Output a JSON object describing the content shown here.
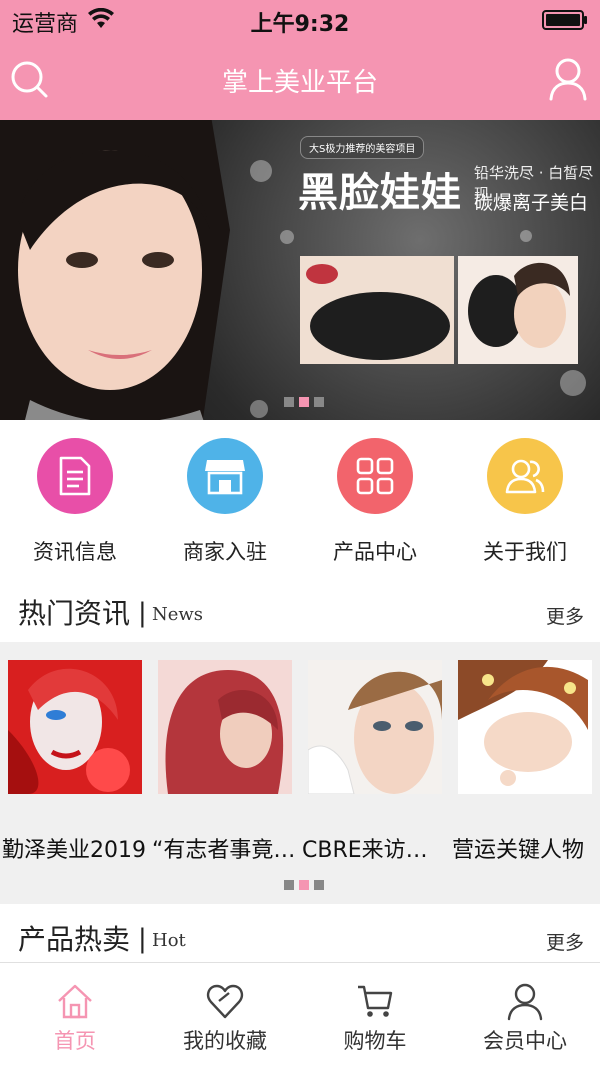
{
  "status_bar": {
    "carrier": "运营商",
    "time": "上午9:32"
  },
  "header": {
    "title": "掌上美业平台"
  },
  "banner": {
    "tag": "大S极力推荐的美容项目",
    "headline": "黑脸娃娃",
    "sub1": "铅华洗尽 · 白皙尽现",
    "sub2": "碳爆离子美白",
    "active_dot": 1
  },
  "categories": [
    {
      "label": "资讯信息",
      "color": "#e84fa8",
      "icon": "document-icon"
    },
    {
      "label": "商家入驻",
      "color": "#4fb3e8",
      "icon": "store-icon"
    },
    {
      "label": "产品中心",
      "color": "#f2646c",
      "icon": "grid-icon"
    },
    {
      "label": "关于我们",
      "color": "#f7c54a",
      "icon": "people-icon"
    }
  ],
  "hot_news": {
    "title": "热门资讯",
    "subtitle": "News",
    "more": "更多",
    "items": [
      {
        "caption": "勤泽美业2019"
      },
      {
        "caption": "“有志者事竟成”"
      },
      {
        "caption": "CBRE来访交流"
      },
      {
        "caption": "营运关键人物"
      }
    ],
    "active_dot": 1
  },
  "hot_products": {
    "title": "产品热卖",
    "subtitle": "Hot",
    "more": "更多"
  },
  "tabbar": [
    {
      "label": "首页",
      "icon": "home-icon",
      "active": true
    },
    {
      "label": "我的收藏",
      "icon": "heart-icon",
      "active": false
    },
    {
      "label": "购物车",
      "icon": "cart-icon",
      "active": false
    },
    {
      "label": "会员中心",
      "icon": "user-icon",
      "active": false
    }
  ],
  "colors": {
    "brand_pink": "#f595b2",
    "gray_bg": "#f0f0f0"
  }
}
